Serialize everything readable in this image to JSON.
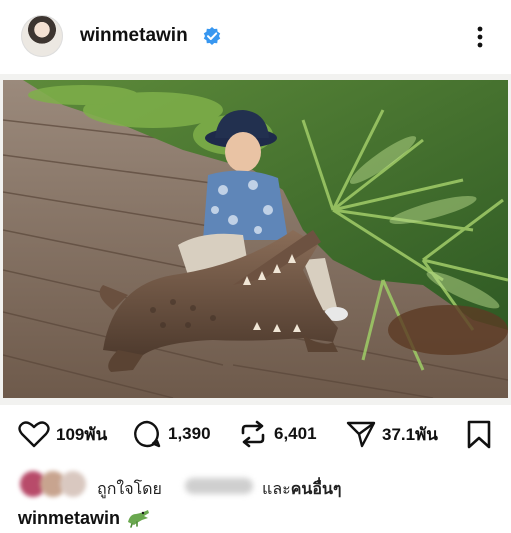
{
  "post": {
    "username": "winmetawin",
    "verified": true,
    "image_alt": "Child in a bucket hat sitting on a crocodile statue on a wooden boardwalk beside tropical plants"
  },
  "actions": {
    "likes": "109พัน",
    "comments": "1,390",
    "reposts": "6,401",
    "shares": "37.1พัน"
  },
  "liked_by": {
    "prefix": "ถูกใจโดย",
    "and_others_1": "และ",
    "and_others_2": "คนอื่นๆ"
  },
  "caption": {
    "username": "winmetawin",
    "emoji_icon": "crocodile-emoji"
  },
  "colors": {
    "verified": "#3897f0",
    "text": "#111111"
  }
}
